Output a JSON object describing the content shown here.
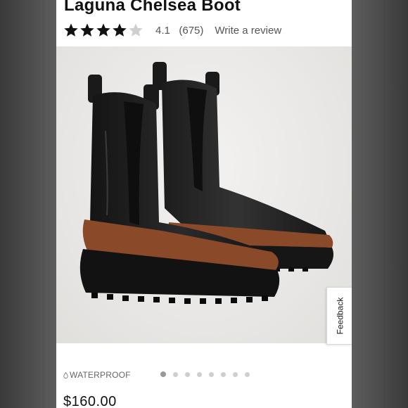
{
  "product": {
    "title": "Laguna Chelsea Boot",
    "rating_value": 4.1,
    "rating_display": "4.1",
    "review_count": "(675)",
    "write_review": "Write a review",
    "stars_filled": 4,
    "stars_total": 5,
    "badge": "WATERPROOF",
    "price": "$160.00"
  },
  "gallery": {
    "image_name": "black-leather-chelsea-boots",
    "image_count": 8,
    "active_index": 0
  },
  "feedback_tab": {
    "label": "Feedback"
  },
  "colors": {
    "star": "#111111",
    "star_empty": "#cfcfcf",
    "sole_accent": "#8a4a2a",
    "background_outer": "#5b5b5b"
  }
}
